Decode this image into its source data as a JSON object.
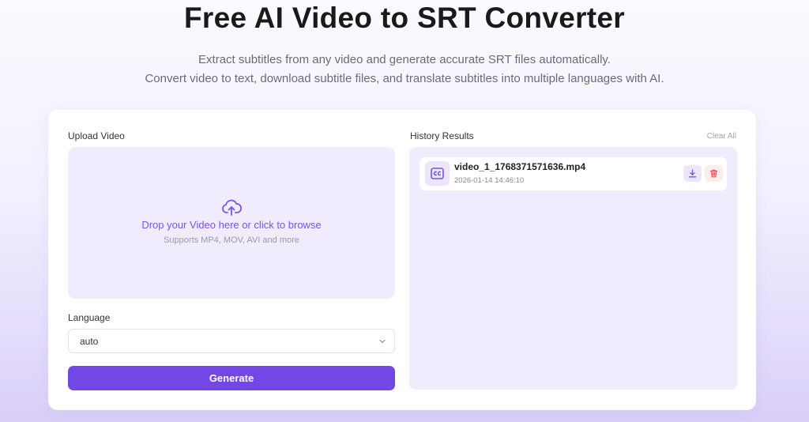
{
  "hero": {
    "title": "Free AI Video to SRT Converter",
    "subtitle_line1": "Extract subtitles from any video and generate accurate SRT files automatically.",
    "subtitle_line2": "Convert video to text, download subtitle files, and translate subtitles into multiple languages with AI."
  },
  "upload": {
    "label": "Upload Video",
    "drop_text": "Drop your Video here or click to browse",
    "drop_hint": "Supports MP4, MOV, AVI and more",
    "icon": "cloud-upload-icon"
  },
  "language": {
    "label": "Language",
    "selected": "auto"
  },
  "generate": {
    "label": "Generate"
  },
  "history": {
    "label": "History Results",
    "clear_all": "Clear All",
    "items": [
      {
        "name": "video_1_1768371571636.mp4",
        "date": "2026-01-14 14:46:10",
        "icon": "cc-icon"
      }
    ]
  },
  "colors": {
    "accent": "#7346e6",
    "panel_bg": "#f0ecfd",
    "delete_red": "#e05656"
  }
}
